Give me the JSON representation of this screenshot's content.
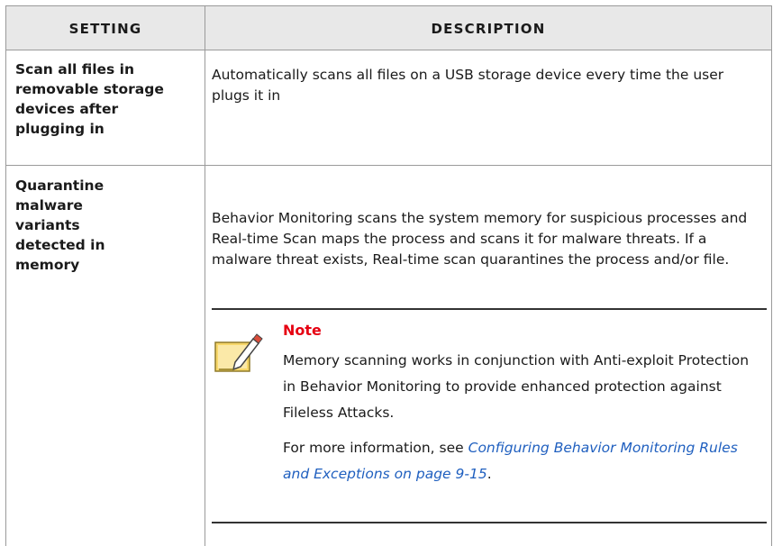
{
  "table": {
    "headers": {
      "setting": "Setting",
      "description": "Description"
    },
    "rows": [
      {
        "setting": "Scan all files in removable storage devices after plugging in",
        "description": "Automatically scans all files on a USB storage device every time the user plugs it in"
      },
      {
        "setting": "Quarantine malware variants detected in memory",
        "description": "Behavior Monitoring scans the system memory for suspicious processes and Real-time Scan maps the process and scans it for malware threats. If a malware threat exists, Real-time scan quarantines the process and/or file.",
        "note": {
          "title": "Note",
          "body": "Memory scanning works in conjunction with Anti-exploit Protection in Behavior Monitoring to provide enhanced protection against Fileless Attacks.",
          "more_prefix": "For more information, see ",
          "link_text": "Configuring Behavior Monitoring Rules and Exceptions on page 9-15",
          "more_suffix": "."
        }
      }
    ]
  },
  "colors": {
    "header_bg": "#e8e8e8",
    "note_title": "#e60012",
    "link": "#1f5fbf"
  },
  "icons": {
    "note": "note-pencil-icon"
  }
}
